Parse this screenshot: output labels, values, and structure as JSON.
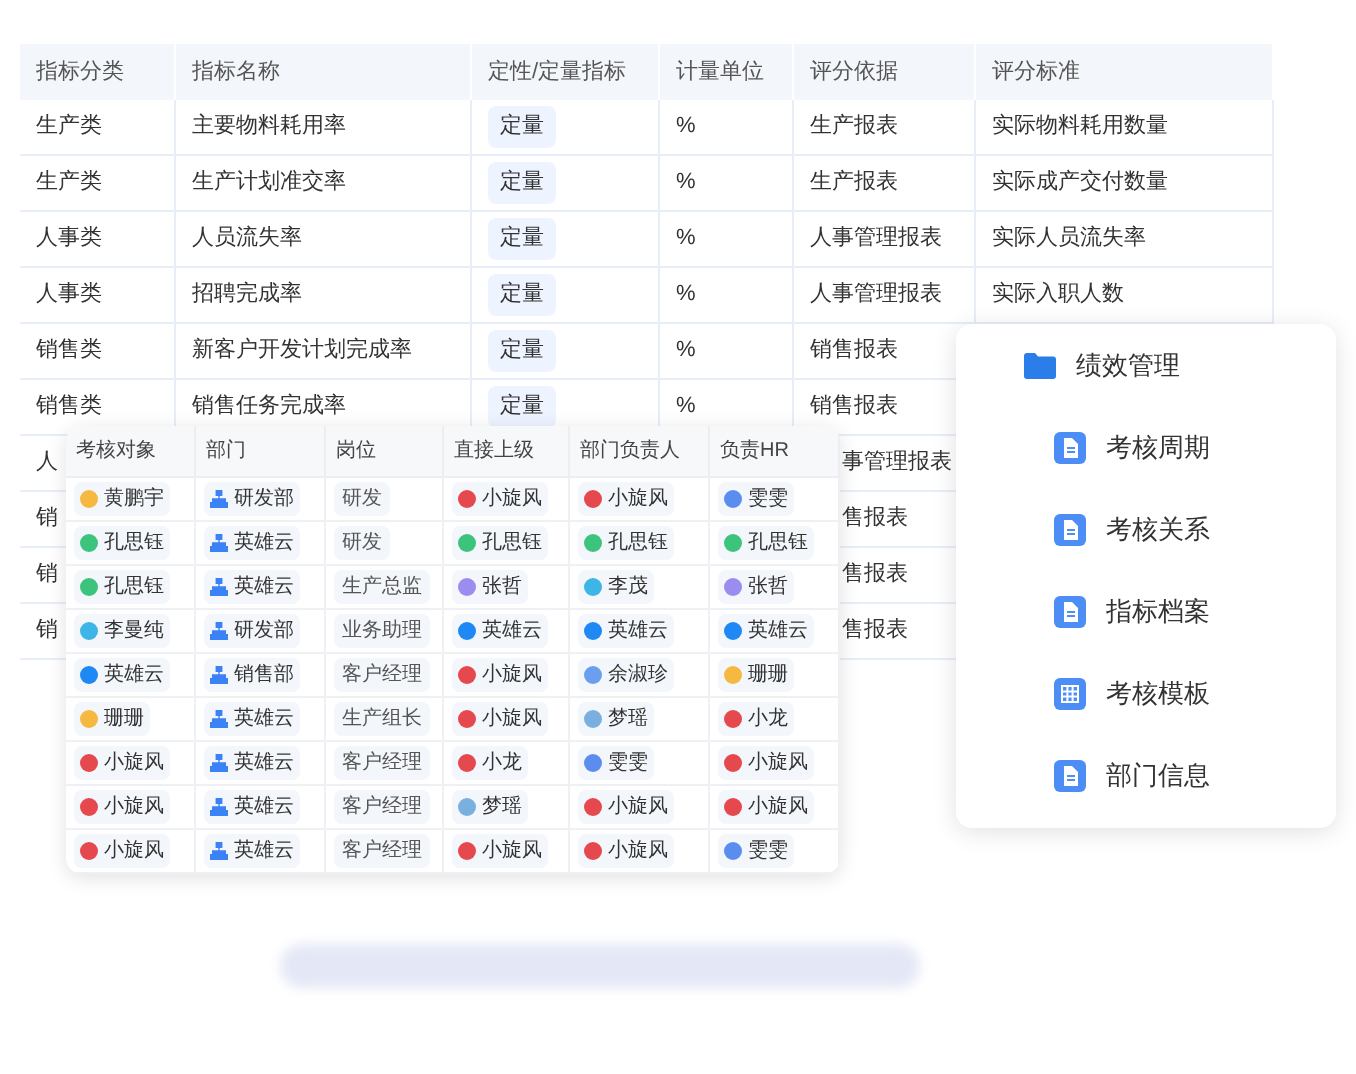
{
  "indicator_table": {
    "columns": [
      "指标分类",
      "指标名称",
      "定性/定量指标",
      "计量单位",
      "评分依据",
      "评分标准"
    ],
    "rows": [
      {
        "category": "生产类",
        "name": "主要物料耗用率",
        "type": "定量",
        "unit": "%",
        "basis": "生产报表",
        "standard": "实际物料耗用数量"
      },
      {
        "category": "生产类",
        "name": "生产计划准交率",
        "type": "定量",
        "unit": "%",
        "basis": "生产报表",
        "standard": "实际成产交付数量"
      },
      {
        "category": "人事类",
        "name": "人员流失率",
        "type": "定量",
        "unit": "%",
        "basis": "人事管理报表",
        "standard": "实际人员流失率"
      },
      {
        "category": "人事类",
        "name": "招聘完成率",
        "type": "定量",
        "unit": "%",
        "basis": "人事管理报表",
        "standard": "实际入职人数"
      },
      {
        "category": "销售类",
        "name": "新客户开发计划完成率",
        "type": "定量",
        "unit": "%",
        "basis": "销售报表"
      },
      {
        "category": "销售类",
        "name": "销售任务完成率",
        "type": "定量",
        "unit": "%",
        "basis": "销售报表"
      },
      {
        "category": "人",
        "basis": "事管理报表"
      },
      {
        "category": "销",
        "basis": "售报表"
      },
      {
        "category": "销",
        "basis": "售报表"
      },
      {
        "category": "销",
        "basis": "售报表"
      }
    ]
  },
  "relation_table": {
    "columns": [
      "考核对象",
      "部门",
      "岗位",
      "直接上级",
      "部门负责人",
      "负责HR"
    ],
    "rows": [
      [
        {
          "kind": "person",
          "text": "黄鹏宇",
          "color": "#f5b942"
        },
        {
          "kind": "dept",
          "text": "研发部"
        },
        {
          "kind": "tag",
          "text": "研发"
        },
        {
          "kind": "person",
          "text": "小旋风",
          "color": "#e5484d"
        },
        {
          "kind": "person",
          "text": "小旋风",
          "color": "#e5484d"
        },
        {
          "kind": "person",
          "text": "雯雯",
          "color": "#5b8def"
        }
      ],
      [
        {
          "kind": "person",
          "text": "孔思钰",
          "color": "#3cc47c"
        },
        {
          "kind": "dept",
          "text": "英雄云"
        },
        {
          "kind": "tag",
          "text": "研发"
        },
        {
          "kind": "person",
          "text": "孔思钰",
          "color": "#3cc47c"
        },
        {
          "kind": "person",
          "text": "孔思钰",
          "color": "#3cc47c"
        },
        {
          "kind": "person",
          "text": "孔思钰",
          "color": "#3cc47c"
        }
      ],
      [
        {
          "kind": "person",
          "text": "孔思钰",
          "color": "#3cc47c"
        },
        {
          "kind": "dept",
          "text": "英雄云"
        },
        {
          "kind": "tag",
          "text": "生产总监"
        },
        {
          "kind": "person",
          "text": "张哲",
          "color": "#9b8cf0"
        },
        {
          "kind": "person",
          "text": "李茂",
          "color": "#3db5e6"
        },
        {
          "kind": "person",
          "text": "张哲",
          "color": "#9b8cf0"
        }
      ],
      [
        {
          "kind": "person",
          "text": "李曼纯",
          "color": "#3db5e6"
        },
        {
          "kind": "dept",
          "text": "研发部"
        },
        {
          "kind": "tag",
          "text": "业务助理"
        },
        {
          "kind": "person",
          "text": "英雄云",
          "color": "#1e88f5"
        },
        {
          "kind": "person",
          "text": "英雄云",
          "color": "#1e88f5"
        },
        {
          "kind": "person",
          "text": "英雄云",
          "color": "#1e88f5"
        }
      ],
      [
        {
          "kind": "person",
          "text": "英雄云",
          "color": "#1e88f5"
        },
        {
          "kind": "dept",
          "text": "销售部"
        },
        {
          "kind": "tag",
          "text": "客户经理"
        },
        {
          "kind": "person",
          "text": "小旋风",
          "color": "#e5484d"
        },
        {
          "kind": "person",
          "text": "余淑珍",
          "color": "#6c9ef0"
        },
        {
          "kind": "person",
          "text": "珊珊",
          "color": "#f5b942"
        }
      ],
      [
        {
          "kind": "person",
          "text": "珊珊",
          "color": "#f5b942"
        },
        {
          "kind": "dept",
          "text": "英雄云"
        },
        {
          "kind": "tag",
          "text": "生产组长"
        },
        {
          "kind": "person",
          "text": "小旋风",
          "color": "#e5484d"
        },
        {
          "kind": "person",
          "text": "梦瑶",
          "color": "#7ab0e0"
        },
        {
          "kind": "person",
          "text": "小龙",
          "color": "#e5484d"
        }
      ],
      [
        {
          "kind": "person",
          "text": "小旋风",
          "color": "#e5484d"
        },
        {
          "kind": "dept",
          "text": "英雄云"
        },
        {
          "kind": "tag",
          "text": "客户经理"
        },
        {
          "kind": "person",
          "text": "小龙",
          "color": "#e5484d"
        },
        {
          "kind": "person",
          "text": "雯雯",
          "color": "#5b8def"
        },
        {
          "kind": "person",
          "text": "小旋风",
          "color": "#e5484d"
        }
      ],
      [
        {
          "kind": "person",
          "text": "小旋风",
          "color": "#e5484d"
        },
        {
          "kind": "dept",
          "text": "英雄云"
        },
        {
          "kind": "tag",
          "text": "客户经理"
        },
        {
          "kind": "person",
          "text": "梦瑶",
          "color": "#7ab0e0"
        },
        {
          "kind": "person",
          "text": "小旋风",
          "color": "#e5484d"
        },
        {
          "kind": "person",
          "text": "小旋风",
          "color": "#e5484d"
        }
      ],
      [
        {
          "kind": "person",
          "text": "小旋风",
          "color": "#e5484d"
        },
        {
          "kind": "dept",
          "text": "英雄云"
        },
        {
          "kind": "tag",
          "text": "客户经理"
        },
        {
          "kind": "person",
          "text": "小旋风",
          "color": "#e5484d"
        },
        {
          "kind": "person",
          "text": "小旋风",
          "color": "#e5484d"
        },
        {
          "kind": "person",
          "text": "雯雯",
          "color": "#5b8def"
        }
      ]
    ]
  },
  "menu": {
    "title": "绩效管理",
    "items": [
      {
        "label": "考核周期",
        "kind": "document"
      },
      {
        "label": "考核关系",
        "kind": "document"
      },
      {
        "label": "指标档案",
        "kind": "document"
      },
      {
        "label": "考核模板",
        "kind": "table"
      },
      {
        "label": "部门信息",
        "kind": "document"
      }
    ]
  }
}
